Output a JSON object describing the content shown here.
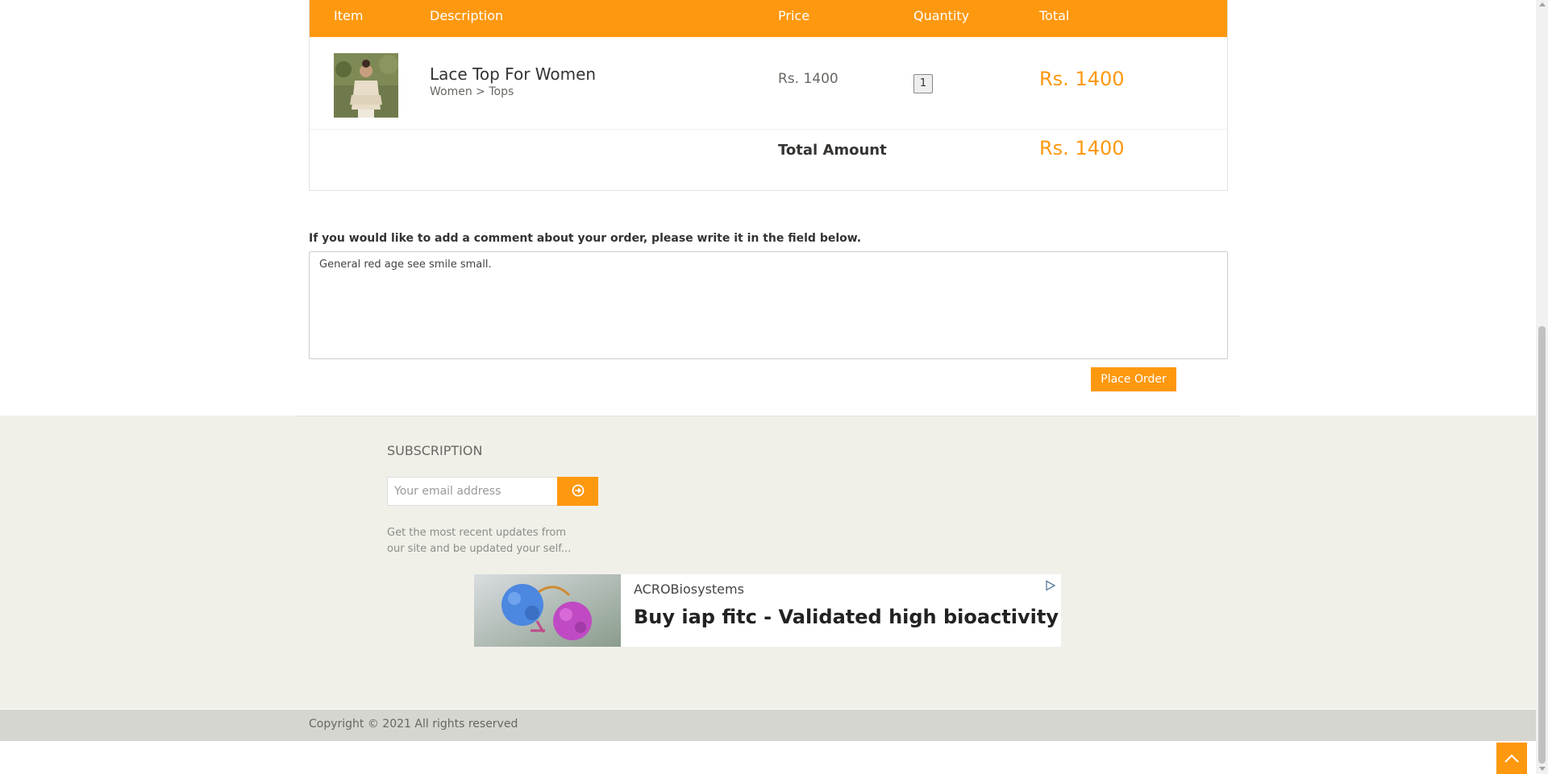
{
  "cart": {
    "headers": {
      "item": "Item",
      "description": "Description",
      "price": "Price",
      "quantity": "Quantity",
      "total": "Total"
    },
    "product": {
      "name": "Lace Top For Women",
      "category": "Women > Tops",
      "price": "Rs. 1400",
      "quantity": "1",
      "total": "Rs. 1400"
    },
    "total_amount_label": "Total Amount",
    "total_amount_value": "Rs. 1400"
  },
  "comment": {
    "label": "If you would like to add a comment about your order, please write it in the field below.",
    "value": "General red age see smile small."
  },
  "place_order_label": "Place Order",
  "subscription": {
    "title": "SUBSCRIPTION",
    "placeholder": "Your email address",
    "description": "Get the most recent updates from our site and be updated your self..."
  },
  "ad": {
    "brand": "ACROBiosystems",
    "headline": "Buy iap fitc - Validated high bioactivity"
  },
  "copyright": "Copyright © 2021 All rights reserved",
  "colors": {
    "accent": "#fe980f",
    "footer_bg": "#f0f0e9",
    "copyright_bg": "#d6d6d0"
  }
}
